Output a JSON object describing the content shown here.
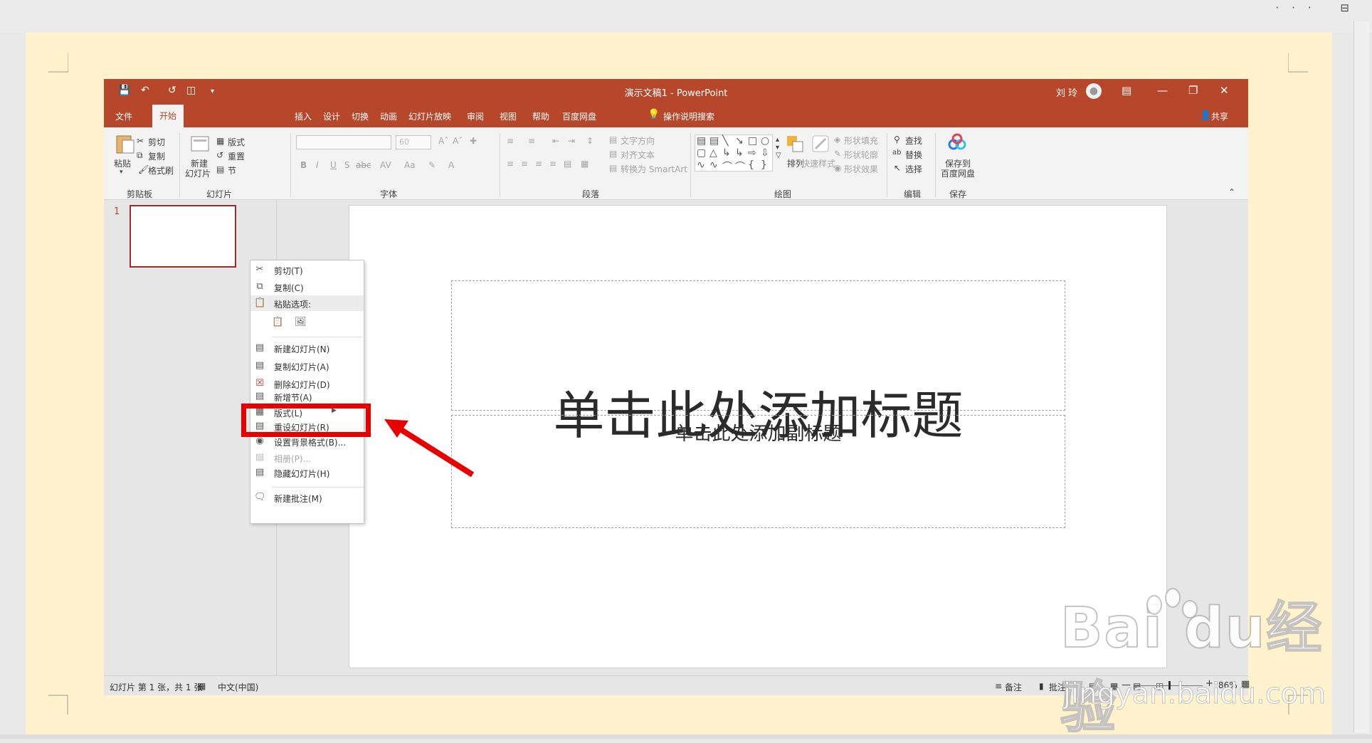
{
  "window": {
    "title": "演示文稿1  -  PowerPoint",
    "user": "刘 玲",
    "outer_controls": "··· ⊟"
  },
  "tabs": [
    "文件",
    "开始",
    "插入",
    "设计",
    "切换",
    "动画",
    "幻灯片放映",
    "审阅",
    "视图",
    "帮助",
    "百度网盘"
  ],
  "tell_me": "操作说明搜索",
  "share": "共享",
  "ribbon": {
    "clipboard": {
      "paste": "粘贴",
      "cut": "剪切",
      "copy": "复制",
      "format_painter": "格式刷",
      "group": "剪贴板"
    },
    "slides": {
      "new_slide_1": "新建",
      "new_slide_2": "幻灯片",
      "layout": "版式",
      "reset": "重置",
      "section": "节",
      "group": "幻灯片"
    },
    "font": {
      "size": "60",
      "group": "字体"
    },
    "paragraph": {
      "text_direction": "文字方向",
      "align_text": "对齐文本",
      "convert_smartart": "转换为 SmartArt",
      "group": "段落"
    },
    "drawing": {
      "arrange": "排列",
      "quick_styles": "快速样式",
      "shape_fill": "形状填充",
      "shape_outline": "形状轮廓",
      "shape_effects": "形状效果",
      "group": "绘图"
    },
    "editing": {
      "find": "查找",
      "replace": "替换",
      "select": "选择",
      "group": "编辑"
    },
    "save": {
      "save_to_1": "保存到",
      "save_to_2": "百度网盘",
      "group": "保存"
    }
  },
  "thumbnail": {
    "number": "1"
  },
  "slide": {
    "title_placeholder": "单击此处添加标题",
    "subtitle_placeholder": "单击此处添加副标题"
  },
  "context_menu": {
    "cut": "剪切(T)",
    "copy": "复制(C)",
    "paste_options": "粘贴选项:",
    "new_slide": "新建幻灯片(N)",
    "duplicate_slide": "复制幻灯片(A)",
    "delete_slide": "删除幻灯片(D)",
    "add_section": "新增节(A)",
    "layout": "版式(L)",
    "reset_slide": "重设幻灯片(R)",
    "format_background": "设置背景格式(B)...",
    "photo_album": "相册(P)...",
    "hide_slide": "隐藏幻灯片(H)",
    "new_comment": "新建批注(M)"
  },
  "status_bar": {
    "slide_info": "幻灯片 第 1 张，共 1 张",
    "language": "中文(中国)",
    "notes": "备注",
    "comments": "批注",
    "zoom": "86%"
  },
  "watermark": {
    "logo": "Bai  du经验",
    "url": "jingyan.baidu.com"
  },
  "colors": {
    "accent": "#b7472a",
    "highlight": "#e60000",
    "page_bg": "#fff2cc"
  }
}
